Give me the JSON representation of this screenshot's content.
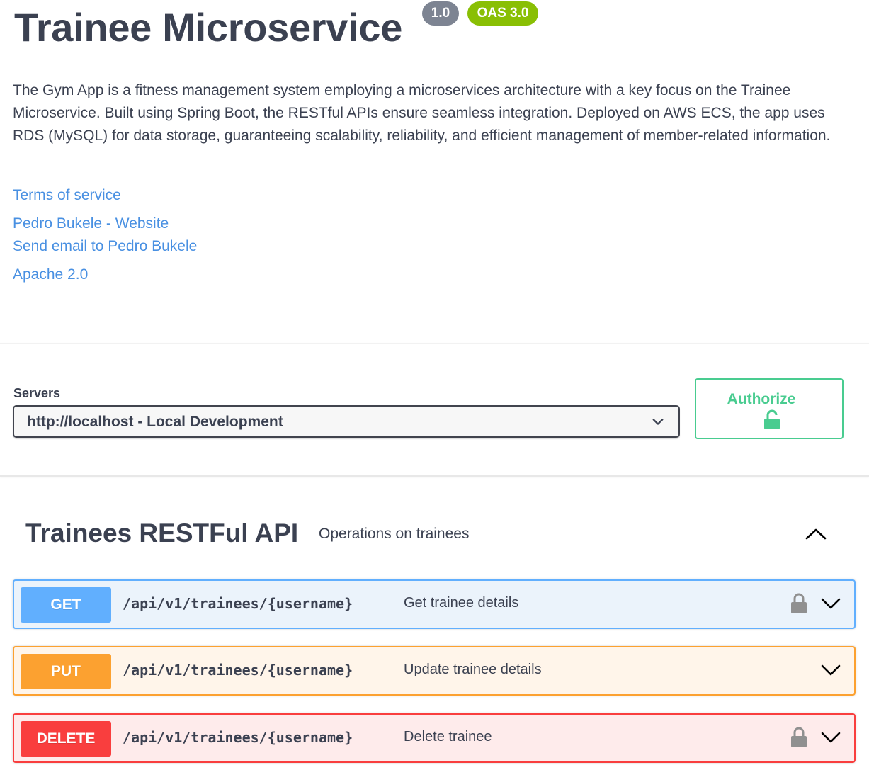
{
  "info": {
    "title": "Trainee Microservice",
    "version": "1.0",
    "oas_version": "OAS 3.0",
    "description": "The Gym App is a fitness management system employing a microservices architecture with a key focus on the Trainee Microservice. Built using Spring Boot, the RESTful APIs ensure seamless integration. Deployed on AWS ECS, the app uses RDS (MySQL) for data storage, guaranteeing scalability, reliability, and efficient management of member-related information.",
    "links": {
      "terms": "Terms of service",
      "website": "Pedro Bukele - Website",
      "email": "Send email to Pedro Bukele",
      "license": "Apache 2.0"
    }
  },
  "servers": {
    "label": "Servers",
    "selected": "http://localhost - Local Development"
  },
  "authorize": {
    "label": "Authorize",
    "icon": "unlocked-icon"
  },
  "tag": {
    "name": "Trainees RESTFul API",
    "description": "Operations on trainees",
    "expanded": true
  },
  "operations": [
    {
      "method": "GET",
      "path": "/api/v1/trainees/{username}",
      "summary": "Get trainee details",
      "locked": true
    },
    {
      "method": "PUT",
      "path": "/api/v1/trainees/{username}",
      "summary": "Update trainee details",
      "locked": false
    },
    {
      "method": "DELETE",
      "path": "/api/v1/trainees/{username}",
      "summary": "Delete trainee",
      "locked": true
    }
  ],
  "colors": {
    "get": "#61affe",
    "put": "#fca130",
    "delete": "#f93e3e",
    "authorize": "#49cc90",
    "link": "#4990e2",
    "version_badge": "#7d8492",
    "oas_badge": "#89bf04"
  }
}
